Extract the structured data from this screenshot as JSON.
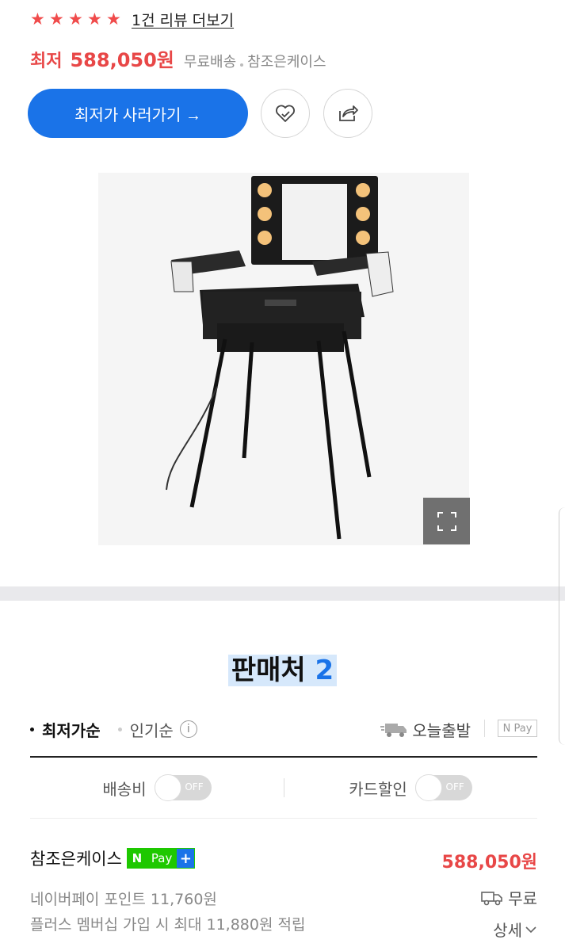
{
  "rating": {
    "stars": [
      "★",
      "★",
      "★",
      "★",
      "★"
    ],
    "review_link": "1건 리뷰 더보기"
  },
  "price_row": {
    "label": "최저",
    "price": "588,050원",
    "shipping": "무료배송",
    "seller": "참조은케이스"
  },
  "actions": {
    "buy_label": "최저가 사러가기 →",
    "zzim_icon": "heart-icon",
    "share_icon": "share-icon"
  },
  "product": {
    "expand_icon": "expand-icon"
  },
  "sellers": {
    "title": "판매처",
    "count": "2"
  },
  "sort": {
    "lowest": "최저가순",
    "popular": "인기순",
    "info": "i",
    "today_ship": "오늘출발",
    "npay_filter": "N Pay"
  },
  "filters": {
    "shipping_label": "배송비",
    "card_label": "카드할인",
    "toggle_off": "OFF"
  },
  "offer": {
    "name": "참조은케이스",
    "badge_n": "N",
    "badge_pay": "Pay",
    "badge_plus": "+",
    "price": "588,050원",
    "point": "네이버페이 포인트 11,760원",
    "plus_benefit": "플러스 멤버십 가입 시 최대 11,880원 적립",
    "shipping": "무료",
    "detail": "상세"
  },
  "colors": {
    "accent_blue": "#1a73e8",
    "price_red": "#e84747",
    "npay_green": "#1ec800"
  }
}
